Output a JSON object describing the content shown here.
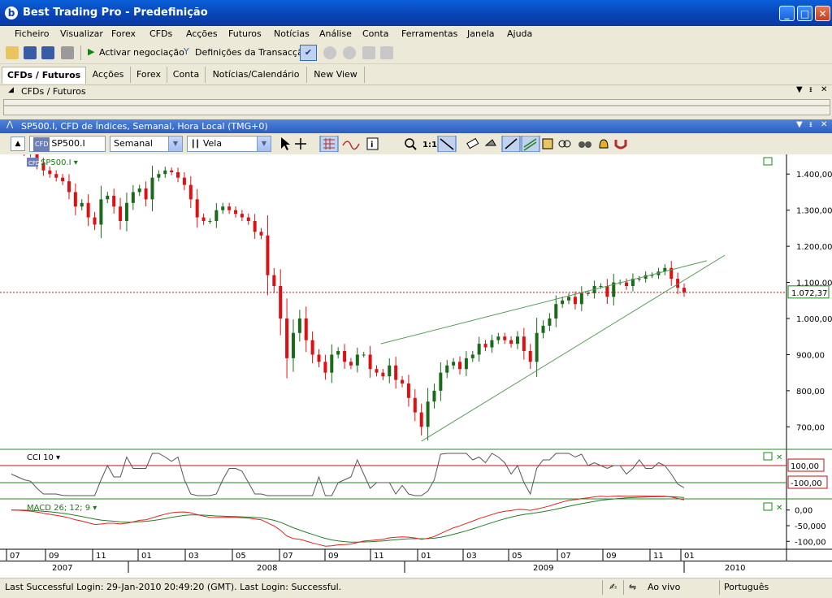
{
  "window": {
    "title": "Best Trading Pro - Predefinição",
    "app_icon": "b",
    "minimize": "_",
    "maximize": "□",
    "close": "✕"
  },
  "menu": [
    "Ficheiro",
    "Visualizar",
    "Forex",
    "CFDs",
    "Acções",
    "Futuros",
    "Notícias",
    "Análise",
    "Conta",
    "Ferramentas",
    "Janela",
    "Ajuda"
  ],
  "toolbar": {
    "activate_trading": "Activar negociação",
    "transaction_settings": "Definições da Transacção"
  },
  "tabs": [
    "CFDs / Futuros",
    "Acções",
    "Forex",
    "Conta",
    "Notícias/Calendário",
    "New View"
  ],
  "panel": {
    "title": "CFDs / Futuros"
  },
  "chart_window": {
    "title": "SP500.I, CFD de Índices, Semanal, Hora Local (TMG+0)",
    "symbol": "SP500.I",
    "period": "Semanal",
    "chart_type": "Vela",
    "symbol_badge": "CFD",
    "legend": "SP500.I",
    "current_price_label": "1.072,37",
    "cci_label": "CCI 10",
    "cci_levels": [
      "100,00",
      "-100,00"
    ],
    "macd_label": "MACD 26; 12; 9",
    "macd_ticks": [
      "0,00",
      "-50,000",
      "-100,00"
    ]
  },
  "chart_data": {
    "type": "candlestick",
    "title": "SP500.I",
    "y_ticks": [
      "1.400,00",
      "1.300,00",
      "1.200,00",
      "1.100,00",
      "1.000,00",
      "900,00",
      "800,00",
      "700,00"
    ],
    "ylim": [
      640,
      1450
    ],
    "month_labels": [
      "07",
      "09",
      "11",
      "01",
      "03",
      "05",
      "07",
      "09",
      "11",
      "01",
      "03",
      "05",
      "07",
      "09",
      "11",
      "01"
    ],
    "year_labels": [
      "2007",
      "2008",
      "2009",
      "2010"
    ],
    "current_price": 1072.37,
    "closes": [
      1480,
      1470,
      1460,
      1455,
      1430,
      1410,
      1400,
      1390,
      1380,
      1350,
      1310,
      1320,
      1280,
      1260,
      1330,
      1340,
      1310,
      1270,
      1320,
      1350,
      1360,
      1330,
      1390,
      1400,
      1410,
      1405,
      1390,
      1370,
      1330,
      1280,
      1270,
      1270,
      1300,
      1310,
      1300,
      1290,
      1280,
      1270,
      1240,
      1230,
      1120,
      1090,
      1000,
      890,
      960,
      1000,
      940,
      900,
      880,
      850,
      900,
      910,
      880,
      870,
      900,
      900,
      860,
      850,
      840,
      870,
      830,
      820,
      780,
      740,
      700,
      770,
      800,
      850,
      870,
      880,
      860,
      890,
      900,
      930,
      920,
      940,
      950,
      940,
      930,
      950,
      910,
      880,
      960,
      980,
      1000,
      1040,
      1050,
      1060,
      1040,
      1070,
      1070,
      1090,
      1090,
      1060,
      1100,
      1100,
      1090,
      1110,
      1110,
      1120,
      1120,
      1130,
      1140,
      1110,
      1085,
      1072
    ]
  },
  "status": {
    "login": "Last Successful Login: 29-Jan-2010 20:49:20 (GMT). Last Login: Successful.",
    "live": "Ao vivo",
    "language": "Português"
  }
}
